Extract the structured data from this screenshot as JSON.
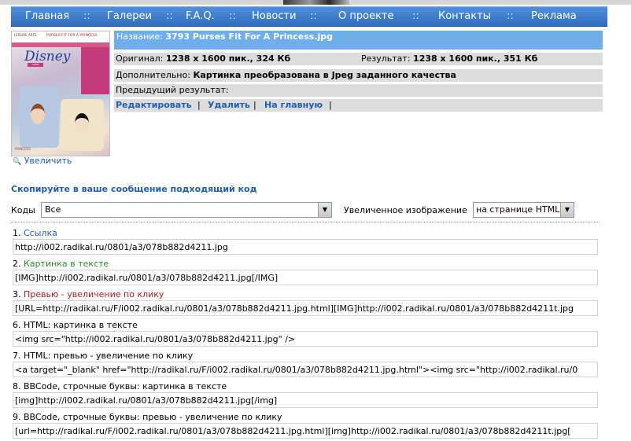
{
  "nav": {
    "items": [
      "Главная",
      "Галереи",
      "F.A.Q.",
      "Новости",
      "О проекте",
      "Контакты",
      "Реклама"
    ],
    "separator": "::"
  },
  "thumbnail": {
    "cover_small_text": "LEISURE ARTS",
    "cover_title": "PURSES FIT FOR A PRINCESS",
    "logo": "Disney",
    "logo_sub": "HOME",
    "bottom_text": "PRINCESS"
  },
  "zoom_link": "Увеличить",
  "info": {
    "title_label": "Название:",
    "title_value": "3793 Purses Fit For A Princess.jpg",
    "original_label": "Оригинал:",
    "original_value": "1238 x 1600 пик., 324 Кб",
    "result_label": "Результат:",
    "result_value": "1238 x 1600 пик., 351 Кб",
    "extra_label": "Дополнительно:",
    "extra_value": "Картинка преобразована в Jpeg заданного качества",
    "prev_label": "Предыдущий результат:",
    "actions": [
      "Редактировать",
      "Удалить",
      "На главную"
    ],
    "action_sep": "|"
  },
  "copy_title": "Скопируйте в ваше сообщение подходящий код",
  "codes": {
    "label": "Коды",
    "selected": "Все",
    "zoom_label": "Увеличенное изображение",
    "zoom_selected": "на странице HTML"
  },
  "code_rows": [
    {
      "num": "1.",
      "label": "Ссылка",
      "value": "http://i002.radikal.ru/0801/a3/078b882d4211.jpg"
    },
    {
      "num": "2.",
      "label": "Картинка в тексте",
      "value": "[IMG]http://i002.radikal.ru/0801/a3/078b882d4211.jpg[/IMG]"
    },
    {
      "num": "3.",
      "label": "Превью - увеличение по клику",
      "value": "[URL=http://radikal.ru/F/i002.radikal.ru/0801/a3/078b882d4211.jpg.html][IMG]http://i002.radikal.ru/0801/a3/078b882d4211t.jpg"
    },
    {
      "num": "6.",
      "label": "HTML: картинка в тексте",
      "value": "<img src=\"http://i002.radikal.ru/0801/a3/078b882d4211.jpg\" />"
    },
    {
      "num": "7.",
      "label": "HTML: превью - увеличение по клику",
      "value": "<a target=\"_blank\" href=\"http://radikal.ru/F/i002.radikal.ru/0801/a3/078b882d4211.jpg.html\"><img src=\"http://i002.radikal.ru/0"
    },
    {
      "num": "8.",
      "label": "BBCode, строчные буквы: картинка в тексте",
      "value": "[img]http://i002.radikal.ru/0801/a3/078b882d4211.jpg[/img]"
    },
    {
      "num": "9.",
      "label": "BBCode, строчные буквы: превью - увеличение по клику",
      "value": "[url=http://radikal.ru/F/i002.radikal.ru/0801/a3/078b882d4211.jpg.html][img]http://i002.radikal.ru/0801/a3/078b882d4211t.jpg["
    }
  ],
  "colors": {
    "nav_bg": "#3a78c9",
    "title_bg": "#6faeea",
    "link": "#1f5fb3",
    "info_bg": "#dcdcdc"
  }
}
